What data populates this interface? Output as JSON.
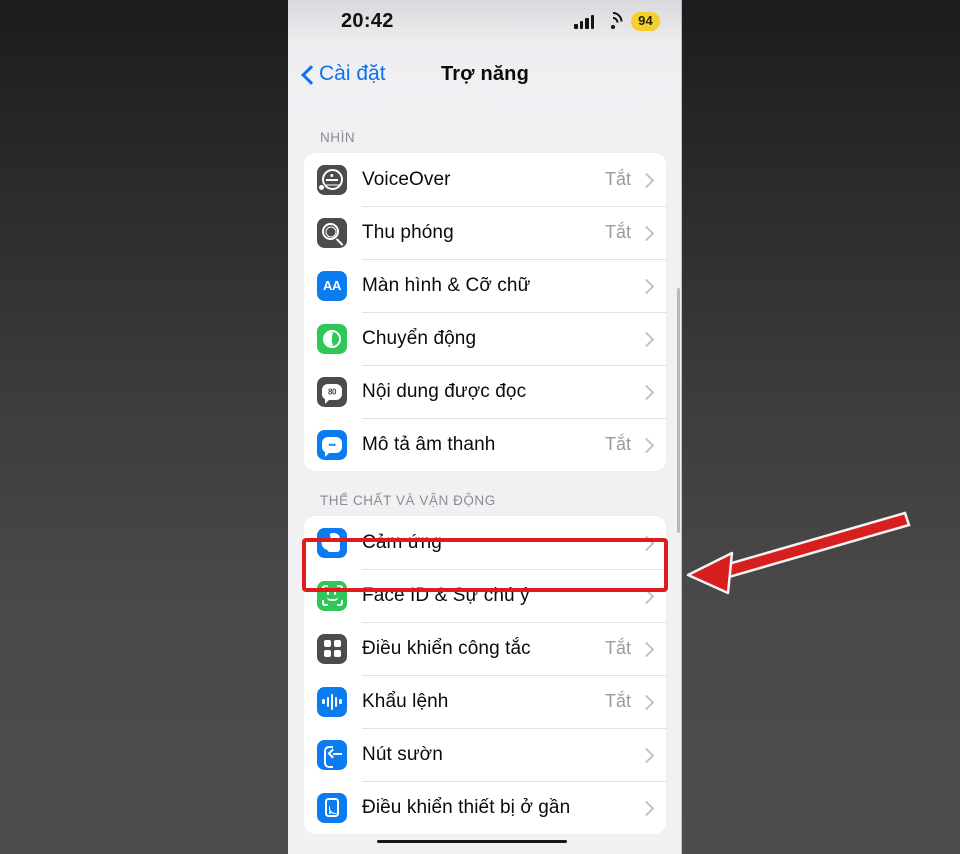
{
  "status_bar": {
    "time": "20:42",
    "signal_icon": "cellular-signal-icon",
    "wifi_icon": "wifi-icon",
    "battery_percent": "94",
    "battery_color": "#f3d02f"
  },
  "nav": {
    "back_label": "Cài đặt",
    "back_icon": "chevron-left-icon",
    "title": "Trợ năng",
    "accent_color": "#1072e8"
  },
  "sections": [
    {
      "header": "NHÌN",
      "rows": [
        {
          "label": "VoiceOver",
          "value": "Tắt",
          "icon": "voiceover-icon",
          "icon_color": "gray"
        },
        {
          "label": "Thu phóng",
          "value": "Tắt",
          "icon": "zoom-icon",
          "icon_color": "gray"
        },
        {
          "label": "Màn hình & Cỡ chữ",
          "value": "",
          "icon": "display-text-size-icon",
          "icon_color": "blue"
        },
        {
          "label": "Chuyển động",
          "value": "",
          "icon": "motion-icon",
          "icon_color": "green"
        },
        {
          "label": "Nội dung được đọc",
          "value": "",
          "icon": "spoken-content-icon",
          "icon_color": "gray"
        },
        {
          "label": "Mô tả âm thanh",
          "value": "Tắt",
          "icon": "audio-description-icon",
          "icon_color": "blue"
        }
      ]
    },
    {
      "header": "THỂ CHẤT VÀ VẬN ĐỘNG",
      "rows": [
        {
          "label": "Cảm ứng",
          "value": "",
          "icon": "touch-icon",
          "icon_color": "blue",
          "highlighted": true
        },
        {
          "label": "Face ID & Sự chú ý",
          "value": "",
          "icon": "face-id-icon",
          "icon_color": "green"
        },
        {
          "label": "Điều khiển công tắc",
          "value": "Tắt",
          "icon": "switch-control-icon",
          "icon_color": "gray"
        },
        {
          "label": "Khẩu lệnh",
          "value": "Tắt",
          "icon": "voice-control-icon",
          "icon_color": "blue"
        },
        {
          "label": "Nút sườn",
          "value": "",
          "icon": "side-button-icon",
          "icon_color": "blue"
        },
        {
          "label": "Điều khiển thiết bị ở gần",
          "value": "",
          "icon": "nearby-device-icon",
          "icon_color": "blue"
        }
      ]
    }
  ],
  "annotations": {
    "highlight_color": "#e01b1b",
    "highlight_target": "Cảm ứng",
    "arrow_icon": "red-arrow-pointing-left"
  }
}
